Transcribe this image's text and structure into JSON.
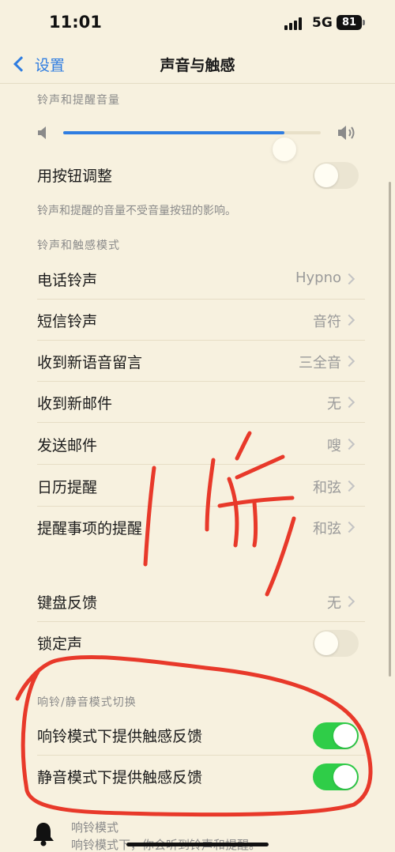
{
  "status_bar": {
    "time": "11:01",
    "network": "5G",
    "battery": "81"
  },
  "nav": {
    "back_label": "设置",
    "title": "声音与触感"
  },
  "volume_section": {
    "header": "铃声和提醒音量",
    "level": 0.86
  },
  "button_adjust": {
    "label": "用按钮调整",
    "on": false,
    "note": "铃声和提醒的音量不受音量按钮的影响。"
  },
  "ringtone_section": {
    "header": "铃声和触感模式",
    "items": [
      {
        "label": "电话铃声",
        "value": "Hypno"
      },
      {
        "label": "短信铃声",
        "value": "音符"
      },
      {
        "label": "收到新语音留言",
        "value": "三全音"
      },
      {
        "label": "收到新邮件",
        "value": "无"
      },
      {
        "label": "发送邮件",
        "value": "嗖"
      },
      {
        "label": "日历提醒",
        "value": "和弦"
      },
      {
        "label": "提醒事项的提醒",
        "value": "和弦"
      }
    ]
  },
  "feedback_section": {
    "keyboard": {
      "label": "键盘反馈",
      "value": "无"
    },
    "lock": {
      "label": "锁定声",
      "on": false
    }
  },
  "haptics_section": {
    "header": "响铃/静音模式切换",
    "items": [
      {
        "label": "响铃模式下提供触感反馈",
        "on": true
      },
      {
        "label": "静音模式下提供触感反馈",
        "on": true
      }
    ]
  },
  "ring_mode": {
    "title": "响铃模式",
    "desc": "响铃模式下，你会听到铃声和提醒。"
  },
  "colors": {
    "background": "#f7f1df",
    "accent": "#2f7de1",
    "toggle_on": "#2fcd48",
    "annotation": "#e8392a"
  },
  "icons": {
    "back": "chevron-left-icon",
    "volume_low": "speaker-low-icon",
    "volume_high": "speaker-high-icon",
    "disclosure": "chevron-right-icon",
    "ring_mode": "bell-icon"
  }
}
